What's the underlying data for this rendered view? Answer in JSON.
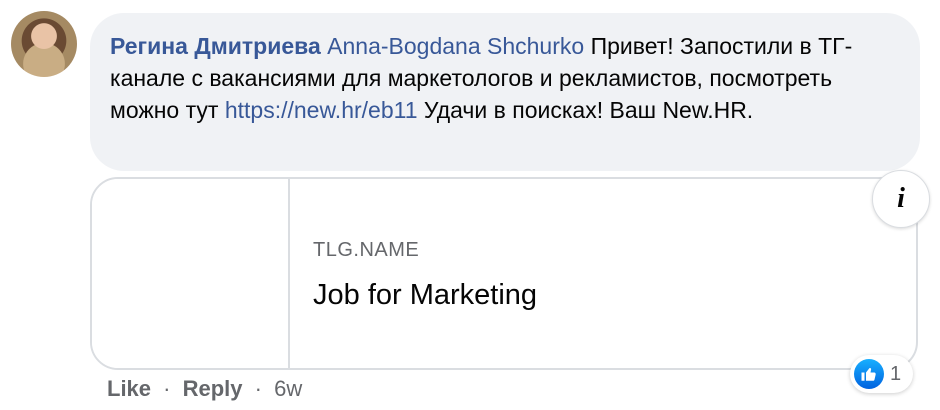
{
  "comment": {
    "author": "Регина Дмитриева",
    "mention": "Anna-Bogdana Shchurko",
    "text_part1": " Привет! Запостили в ТГ-канале с вакансиями для маркетологов и рекламистов, посмотреть можно тут ",
    "link": "https://new.hr/eb11",
    "text_part2": " Удачи в поисках! Ваш New.HR."
  },
  "link_preview": {
    "domain": "TLG.NAME",
    "title": "Job for Marketing",
    "info_icon": "i"
  },
  "actions": {
    "like": "Like",
    "separator": "·",
    "reply": "Reply",
    "time": "6w"
  },
  "reactions": {
    "icon": "like-icon",
    "count": "1",
    "color": "#1877f2"
  }
}
